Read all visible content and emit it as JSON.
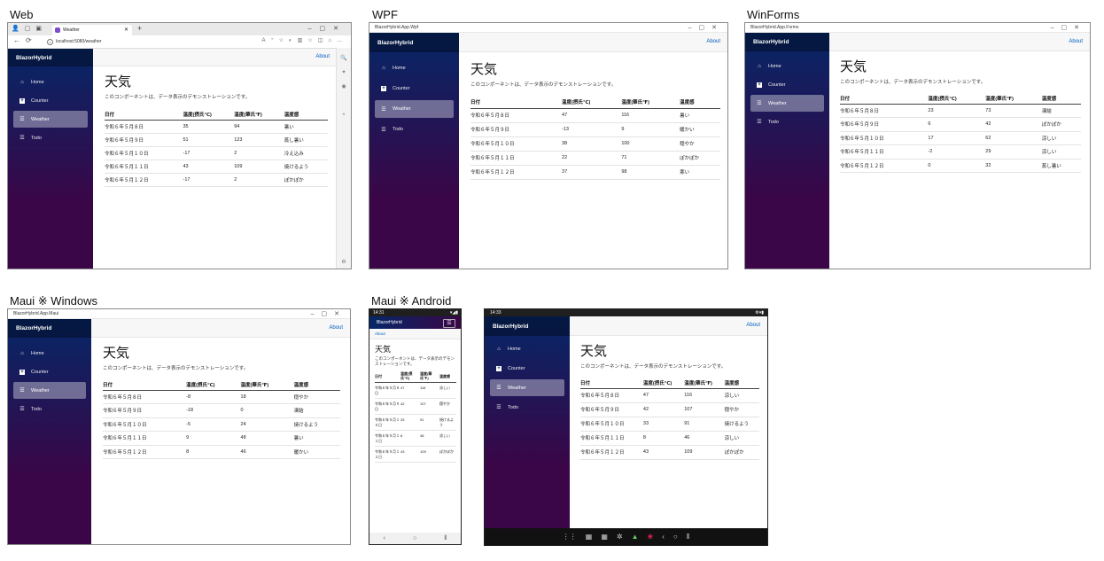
{
  "captions": {
    "web": "Web",
    "wpf": "WPF",
    "winforms": "WinForms",
    "maui_windows": "Maui ※ Windows",
    "maui_android": "Maui ※ Android"
  },
  "common": {
    "brand": "BlazorHybrid",
    "about": "About",
    "nav": [
      "Home",
      "Counter",
      "Weather",
      "Todo"
    ],
    "heading": "天気",
    "description": "このコンポーネントは、データ表示のデモンストレーションです。",
    "columns_c": [
      "日付",
      "温度(摂氏℃)",
      "温度(華氏℉)",
      "温度感"
    ]
  },
  "colors": {
    "sidebar_top": "#052767",
    "sidebar_bottom": "#3a0647",
    "link": "#0060c0"
  },
  "web": {
    "tab_title": "Weather",
    "url": "localhost:5080/weather",
    "rows": [
      [
        "令和６年５月８日",
        "35",
        "94",
        "暑い"
      ],
      [
        "令和６年５月９日",
        "51",
        "123",
        "蒸し暑い"
      ],
      [
        "令和６年５月１０日",
        "-17",
        "2",
        "冷え込み"
      ],
      [
        "令和６年５月１１日",
        "43",
        "109",
        "焼けるよう"
      ],
      [
        "令和６年５月１２日",
        "-17",
        "2",
        "ぽかぽか"
      ]
    ]
  },
  "wpf": {
    "window_title": "BlazorHybrid.App.Wpf",
    "rows": [
      [
        "令和６年５月８日",
        "47",
        "116",
        "暑い"
      ],
      [
        "令和６年５月９日",
        "-13",
        "9",
        "暖かい"
      ],
      [
        "令和６年５月１０日",
        "38",
        "100",
        "穏やか"
      ],
      [
        "令和６年５月１１日",
        "22",
        "71",
        "ぽかぽか"
      ],
      [
        "令和６年５月１２日",
        "37",
        "98",
        "寒い"
      ]
    ]
  },
  "winforms": {
    "window_title": "BlazorHybrid.App.Forms",
    "rows": [
      [
        "令和６年５月８日",
        "23",
        "73",
        "凍結"
      ],
      [
        "令和６年５月９日",
        "6",
        "42",
        "ぽかぽか"
      ],
      [
        "令和６年５月１０日",
        "17",
        "62",
        "涼しい"
      ],
      [
        "令和６年５月１１日",
        "-2",
        "29",
        "涼しい"
      ],
      [
        "令和６年５月１２日",
        "0",
        "32",
        "蒸し暑い"
      ]
    ]
  },
  "maui_windows": {
    "window_title": "BlazorHybrid.App.Maui",
    "rows": [
      [
        "令和６年５月８日",
        "-8",
        "18",
        "穏やか"
      ],
      [
        "令和６年５月９日",
        "-18",
        "0",
        "凍結"
      ],
      [
        "令和６年５月１０日",
        "-5",
        "24",
        "焼けるよう"
      ],
      [
        "令和６年５月１１日",
        "9",
        "48",
        "暑い"
      ],
      [
        "令和６年５月１２日",
        "8",
        "46",
        "暖かい"
      ]
    ]
  },
  "maui_phone": {
    "time": "14:31",
    "columns": [
      "日付",
      "温度(摂氏℃)",
      "温度(華氏℉)",
      "温度感"
    ],
    "rows": [
      [
        "令和６年５月８日",
        "47",
        "116",
        "涼しい"
      ],
      [
        "令和６年５月９日",
        "42",
        "107",
        "穏やか"
      ],
      [
        "令和６年５月１０日",
        "33",
        "91",
        "焼けるよう"
      ],
      [
        "令和６年５月１１日",
        "8",
        "46",
        "涼しい"
      ],
      [
        "令和６年５月１２日",
        "43",
        "109",
        "ぽかぽか"
      ]
    ]
  },
  "maui_tablet": {
    "time": "14:33",
    "columns": [
      "日付",
      "温度(摂氏℃)",
      "温度(華氏℉)",
      "温度感"
    ],
    "rows": [
      [
        "令和６年５月８日",
        "47",
        "116",
        "涼しい"
      ],
      [
        "令和６年５月９日",
        "42",
        "107",
        "穏やか"
      ],
      [
        "令和６年５月１０日",
        "33",
        "91",
        "焼けるよう"
      ],
      [
        "令和６年５月１１日",
        "8",
        "46",
        "涼しい"
      ],
      [
        "令和６年５月１２日",
        "43",
        "109",
        "ぽかぽか"
      ]
    ]
  }
}
